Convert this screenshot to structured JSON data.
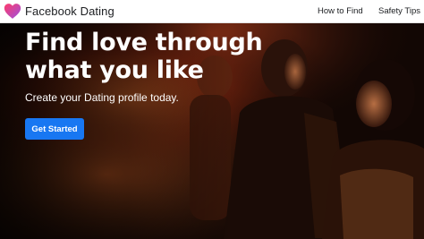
{
  "header": {
    "brand": "Facebook Dating",
    "nav": [
      {
        "label": "How to Find"
      },
      {
        "label": "Safety Tips"
      }
    ]
  },
  "hero": {
    "headline": "Find love through what you like",
    "subtitle": "Create your Dating profile today.",
    "cta_label": "Get Started"
  },
  "colors": {
    "brand_gradient_start": "#ff3b6b",
    "brand_gradient_end": "#9b51e0",
    "cta": "#1877f2"
  },
  "icons": {
    "logo": "heart-icon"
  }
}
